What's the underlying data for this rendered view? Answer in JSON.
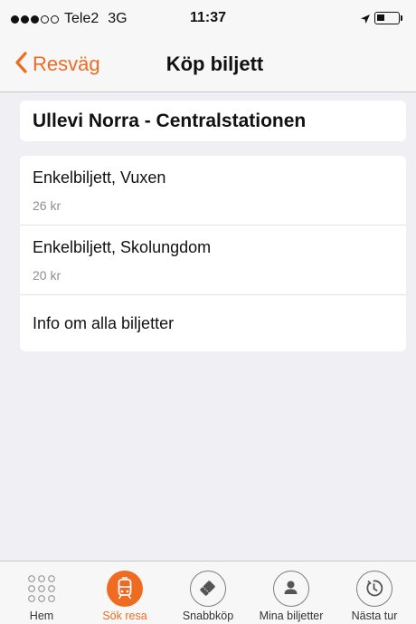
{
  "status_bar": {
    "carrier": "Tele2",
    "network": "3G",
    "time": "11:37",
    "signal_bars": 3,
    "signal_max": 5,
    "icons": [
      "location-arrow-icon",
      "battery-icon"
    ]
  },
  "nav": {
    "back_label": "Resväg",
    "title": "Köp biljett"
  },
  "route": {
    "label": "Ullevi Norra - Centralstationen"
  },
  "tickets": [
    {
      "name": "Enkelbiljett, Vuxen",
      "price": "26 kr"
    },
    {
      "name": "Enkelbiljett, Skolungdom",
      "price": "20 kr"
    }
  ],
  "info_link": "Info om alla biljetter",
  "tabs": [
    {
      "label": "Hem",
      "icon": "grid-icon",
      "active": false
    },
    {
      "label": "Sök resa",
      "icon": "tram-icon",
      "active": true
    },
    {
      "label": "Snabbköp",
      "icon": "ticket-icon",
      "active": false
    },
    {
      "label": "Mina biljetter",
      "icon": "user-icon",
      "active": false
    },
    {
      "label": "Nästa tur",
      "icon": "clock-icon",
      "active": false
    }
  ],
  "colors": {
    "accent": "#f06b22",
    "background": "#efeff4",
    "secondary_text": "#8e8e93"
  }
}
